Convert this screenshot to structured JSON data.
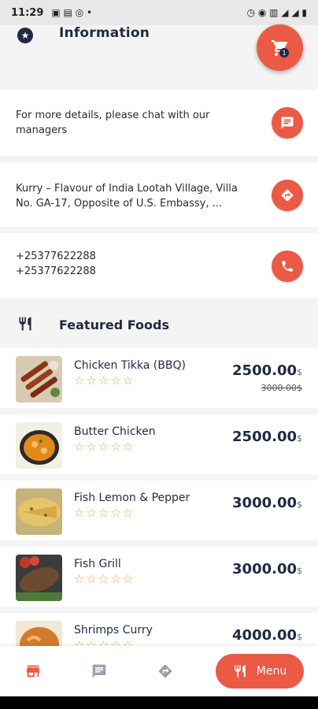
{
  "status": {
    "time": "11:29"
  },
  "info": {
    "title": "Information",
    "chat_text": "For more details, please chat with our managers",
    "address_text": "Kurry – Flavour of India Lootah Village, Villa No. GA-17, Opposite of U.S. Embassy, ...",
    "phone_1": "+25377622288",
    "phone_2": "+25377622288"
  },
  "cart": {
    "badge": "1"
  },
  "featured": {
    "title": "Featured Foods",
    "currency": "$",
    "items": [
      {
        "name": "Chicken Tikka (BBQ)",
        "price": "2500.00",
        "old_price": "3000.00$",
        "rating": 0
      },
      {
        "name": "Butter Chicken",
        "price": "2500.00",
        "rating": 0
      },
      {
        "name": "Fish Lemon & Pepper",
        "price": "3000.00",
        "rating": 0
      },
      {
        "name": "Fish Grill",
        "price": "3000.00",
        "rating": 0
      },
      {
        "name": "Shrimps Curry",
        "price": "4000.00",
        "rating": 0
      }
    ]
  },
  "bottom_nav": {
    "menu_label": "Menu"
  },
  "colors": {
    "accent": "#ea5a44",
    "navy": "#1f2a44",
    "star": "#f0a830"
  }
}
